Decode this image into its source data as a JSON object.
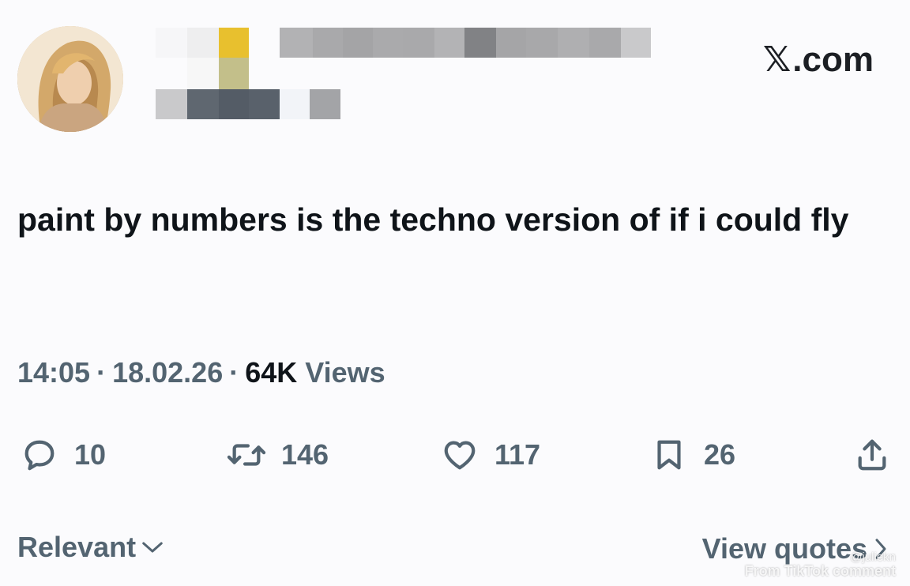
{
  "header": {
    "site_mark": "𝕏",
    "site_text": ".com"
  },
  "tweet": {
    "text": "paint by numbers is the techno version of if i could fly"
  },
  "meta": {
    "time": "14:05",
    "separator": "·",
    "date": "18.02.26",
    "views_count": "64K",
    "views_label": "Views"
  },
  "actions": {
    "replies": "10",
    "reposts": "146",
    "likes": "117",
    "bookmarks": "26"
  },
  "footer": {
    "sort_label": "Relevant",
    "quotes_label": "View quotes"
  },
  "watermark": {
    "handle": "@juliekn",
    "from": "From TikTok comment"
  },
  "colors": {
    "text_primary": "#0f1419",
    "text_secondary": "#536471",
    "background": "#fbfbfd"
  },
  "icons": {
    "reply": "reply-icon",
    "repost": "repost-icon",
    "like": "heart-icon",
    "bookmark": "bookmark-icon",
    "share": "share-icon"
  }
}
